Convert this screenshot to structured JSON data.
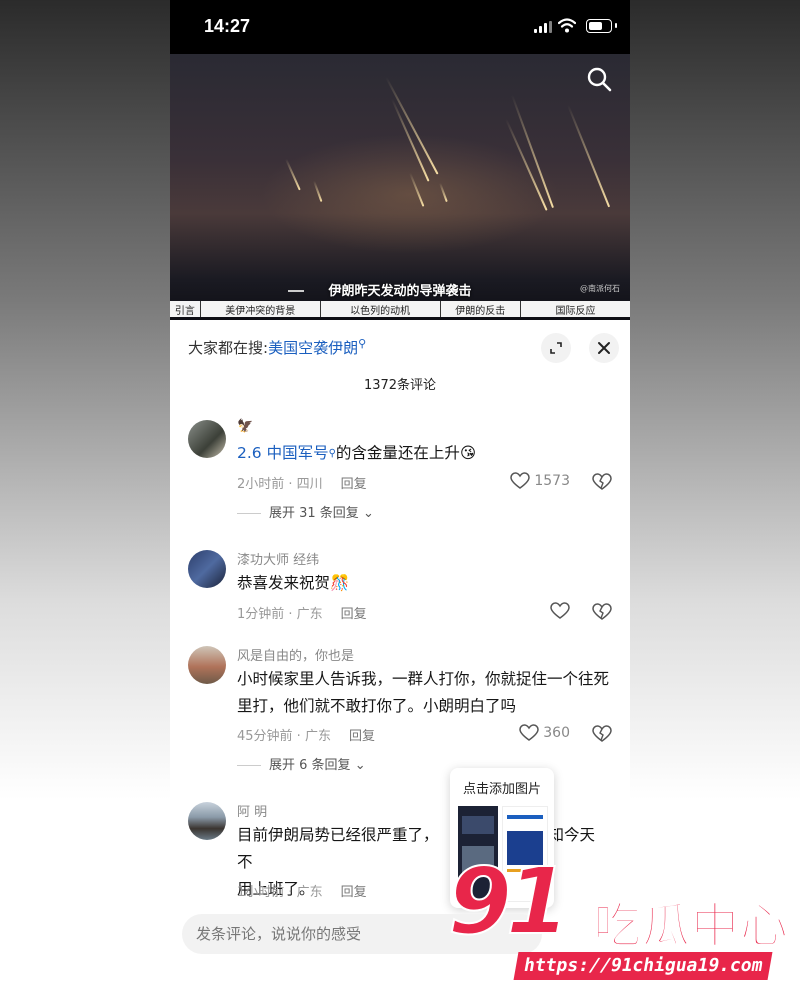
{
  "status_bar": {
    "time": "14:27"
  },
  "video": {
    "caption": "伊朗昨天发动的导弹袭击",
    "source_mark": "@南派何石",
    "chapters": [
      "引言",
      "美伊冲突的背景",
      "以色列的动机",
      "伊朗的反击",
      "国际反应"
    ]
  },
  "sheet": {
    "hot_search_label": "大家都在搜:",
    "hot_search_keyword": "美国空袭伊朗",
    "comment_count": "1372条评论"
  },
  "comments": [
    {
      "username": "🦅",
      "text_link": "2.6 中国军号",
      "text_rest": "的含金量还在上升😘",
      "meta_time": "2小时前 · 四川",
      "reply": "回复",
      "likes": "1573",
      "expand": "展开 31 条回复"
    },
    {
      "username": "漆功大师 经纬",
      "text": "恭喜发来祝贺🎊",
      "meta_time": "1分钟前 · 广东",
      "reply": "回复"
    },
    {
      "username": "风是自由的，你也是",
      "text": "小时候家里人告诉我，一群人打你，你就捉住一个往死里打，他们就不敢打你了。小朗明白了吗",
      "meta_time": "45分钟前 · 广东",
      "reply": "回复",
      "likes": "360",
      "expand": "展开 6 条回复"
    },
    {
      "username": "阿 明",
      "text_a": "目前伊朗局势已经很严重了，",
      "text_b": "知今天不",
      "text_c": "用上班了。",
      "meta_time": "1小时前 · 广东",
      "reply": "回复"
    }
  ],
  "popup": {
    "title": "点击添加图片"
  },
  "input": {
    "placeholder": "发条评论，说说你的感受"
  },
  "watermark": {
    "number": "91",
    "text": "吃瓜中心",
    "url": "https://91chigua19.com"
  },
  "colors": {
    "link": "#1b5fbf",
    "brand": "#e8264a"
  }
}
